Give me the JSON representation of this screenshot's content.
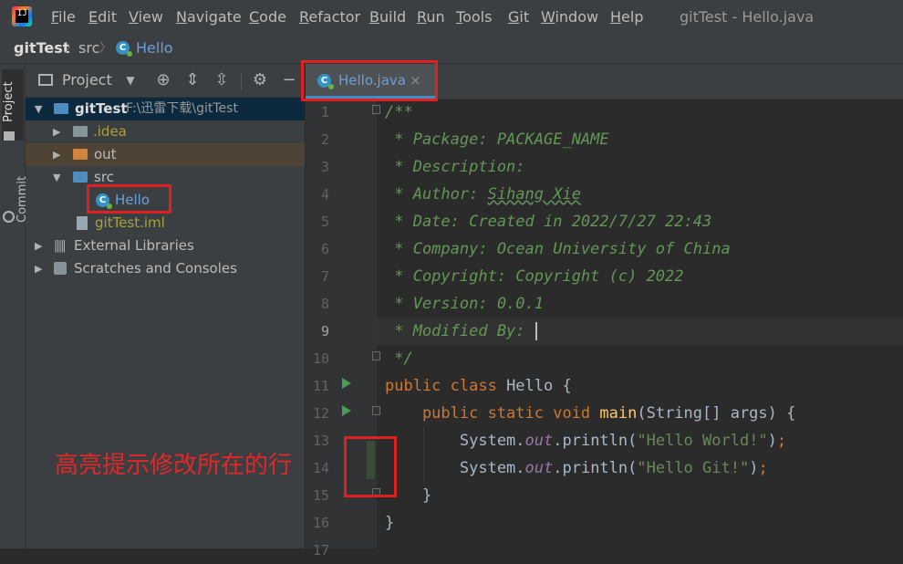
{
  "menu": [
    "File",
    "Edit",
    "View",
    "Navigate",
    "Code",
    "Refactor",
    "Build",
    "Run",
    "Tools",
    "Git",
    "Window",
    "Help"
  ],
  "window_title": "gitTest - Hello.java",
  "breadcrumb": {
    "project": "gitTest",
    "folder": "src",
    "file": "Hello"
  },
  "left_strip": {
    "project": "Project",
    "commit": "Commit"
  },
  "project_panel": {
    "title": "Project",
    "tree": [
      {
        "label": "gitTest",
        "path": "F:\\迅雷下载\\gitTest"
      },
      {
        "label": ".idea"
      },
      {
        "label": "out"
      },
      {
        "label": "src"
      },
      {
        "label": "Hello"
      },
      {
        "label": "gitTest.iml"
      },
      {
        "label": "External Libraries"
      },
      {
        "label": "Scratches and Consoles"
      }
    ]
  },
  "editor": {
    "tab_label": "Hello.java",
    "line_numbers": [
      "1",
      "2",
      "3",
      "4",
      "5",
      "6",
      "7",
      "8",
      "9",
      "10",
      "11",
      "12",
      "13",
      "14",
      "15",
      "16",
      "17"
    ],
    "code": {
      "l1": "/**",
      "l2": " * Package: PACKAGE_NAME",
      "l3": " * Description:",
      "l4a": " * Author: ",
      "l4b": "Sihang Xie",
      "l5": " * Date: Created in 2022/7/27 22:43",
      "l6": " * Company: Ocean University of China",
      "l7": " * Copyright: Copyright (c) 2022",
      "l8": " * Version: 0.0.1",
      "l9": " * Modified By:",
      "l10": " */",
      "l11_kw": "public class ",
      "l11_rest": "Hello {",
      "l12_kw": "    public static void ",
      "l12_fn": "main",
      "l12_rest": "(String[] args) {",
      "l13_a": "        System.",
      "l13_field": "out",
      "l13_b": ".println(",
      "l13_str": "\"Hello World!\"",
      "l13_c": ")",
      "l13_semi": ";",
      "l14_a": "        System.",
      "l14_field": "out",
      "l14_b": ".println(",
      "l14_str": "\"Hello Git!\"",
      "l14_c": ")",
      "l14_semi": ";",
      "l15": "    }",
      "l16": "}"
    }
  },
  "annotation": "高亮提示修改所在的行",
  "colors": {
    "accent": "#4a88c7",
    "annotation_red": "#e02020",
    "change_green": "#384c38"
  }
}
